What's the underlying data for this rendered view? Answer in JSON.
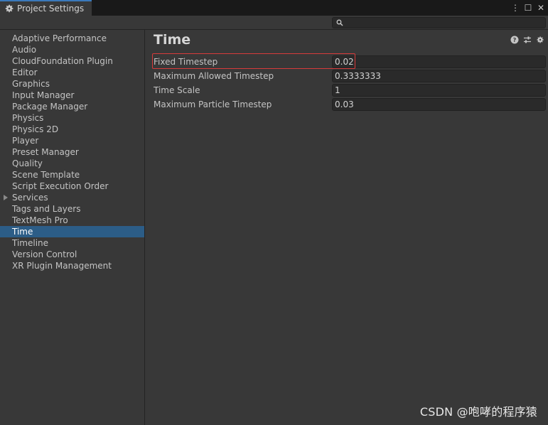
{
  "window": {
    "tab_title": "Project Settings",
    "controls": [
      "⋮",
      "☐",
      "✕"
    ]
  },
  "search": {
    "placeholder": "",
    "value": ""
  },
  "sidebar": {
    "items": [
      {
        "label": "Adaptive Performance"
      },
      {
        "label": "Audio"
      },
      {
        "label": "CloudFoundation Plugin"
      },
      {
        "label": "Editor"
      },
      {
        "label": "Graphics"
      },
      {
        "label": "Input Manager"
      },
      {
        "label": "Package Manager"
      },
      {
        "label": "Physics"
      },
      {
        "label": "Physics 2D"
      },
      {
        "label": "Player"
      },
      {
        "label": "Preset Manager"
      },
      {
        "label": "Quality"
      },
      {
        "label": "Scene Template"
      },
      {
        "label": "Script Execution Order"
      },
      {
        "label": "Services",
        "expandable": true
      },
      {
        "label": "Tags and Layers"
      },
      {
        "label": "TextMesh Pro"
      },
      {
        "label": "Time",
        "selected": true
      },
      {
        "label": "Timeline"
      },
      {
        "label": "Version Control"
      },
      {
        "label": "XR Plugin Management"
      }
    ]
  },
  "main": {
    "title": "Time",
    "icons": [
      "help-icon",
      "presets-icon",
      "settings-gear-icon"
    ],
    "properties": [
      {
        "label": "Fixed Timestep",
        "value": "0.02",
        "highlighted": true
      },
      {
        "label": "Maximum Allowed Timestep",
        "value": "0.3333333"
      },
      {
        "label": "Time Scale",
        "value": "1"
      },
      {
        "label": "Maximum Particle Timestep",
        "value": "0.03"
      }
    ]
  },
  "colors": {
    "background": "#383838",
    "titlebar": "#191919",
    "selection": "#2c5d87",
    "field": "#2a2a2a",
    "highlight": "#d83b3b",
    "tab_accent": "#3a79bb"
  },
  "watermark": "CSDN @咆哮的程序猿"
}
